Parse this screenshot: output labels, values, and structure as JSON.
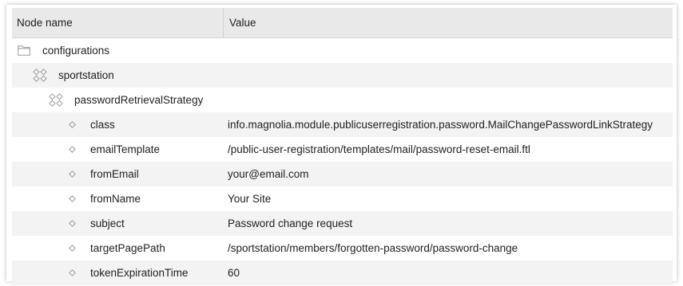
{
  "header": {
    "name_label": "Node name",
    "value_label": "Value"
  },
  "rows": [
    {
      "name": "configurations",
      "value": "",
      "icon": "folder-icon"
    },
    {
      "name": "sportstation",
      "value": "",
      "icon": "content-node-icon"
    },
    {
      "name": "passwordRetrievalStrategy",
      "value": "",
      "icon": "content-node-icon"
    },
    {
      "name": "class",
      "value": "info.magnolia.module.publicuserregistration.password.MailChangePasswordLinkStrategy",
      "icon": "property-icon"
    },
    {
      "name": "emailTemplate",
      "value": "/public-user-registration/templates/mail/password-reset-email.ftl",
      "icon": "property-icon"
    },
    {
      "name": "fromEmail",
      "value": "your@email.com",
      "icon": "property-icon"
    },
    {
      "name": "fromName",
      "value": "Your Site",
      "icon": "property-icon"
    },
    {
      "name": "subject",
      "value": "Password change request",
      "icon": "property-icon"
    },
    {
      "name": "targetPagePath",
      "value": "/sportstation/members/forgotten-password/password-change",
      "icon": "property-icon"
    },
    {
      "name": "tokenExpirationTime",
      "value": "60",
      "icon": "property-icon"
    }
  ],
  "colors": {
    "header_bg": "#e9e9e9",
    "row_alt_bg": "#f3f3f3",
    "icon_stroke": "#9a9a9a"
  }
}
